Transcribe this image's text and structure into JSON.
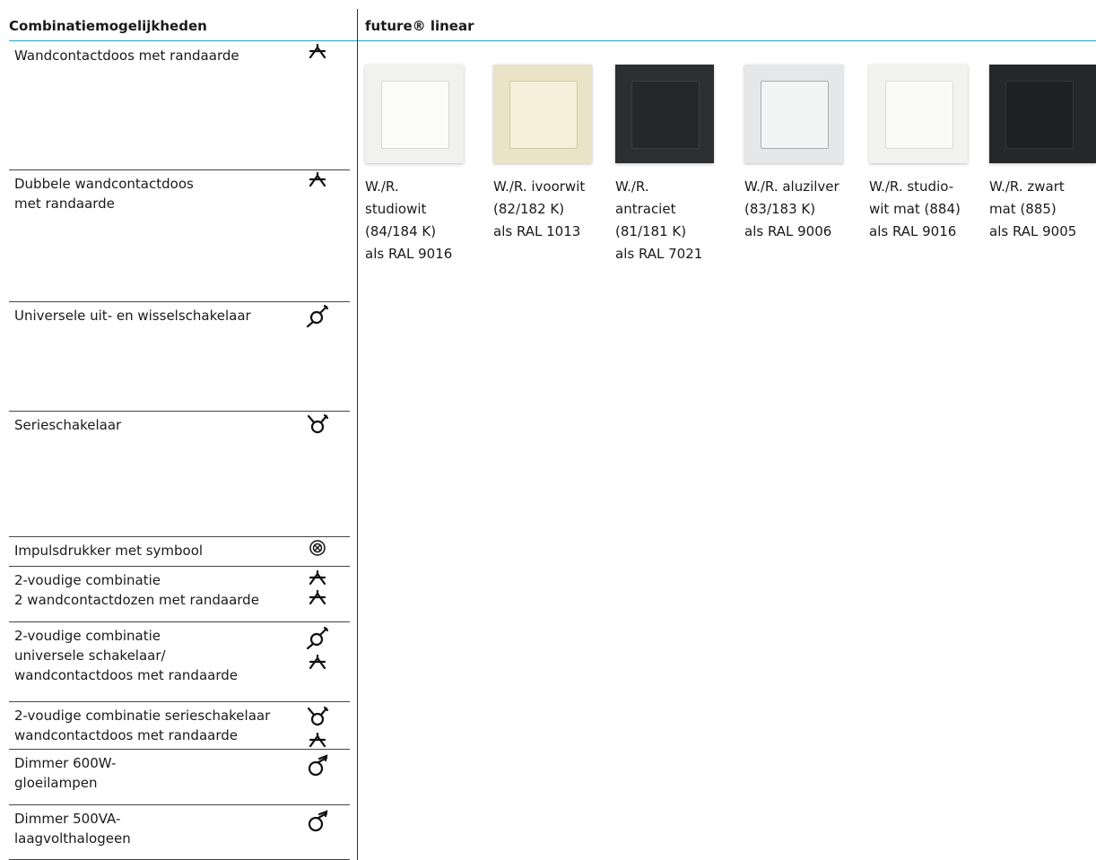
{
  "header": {
    "left_title": "Combinatiemogelijkheden",
    "right_title": "future® linear"
  },
  "rows": [
    {
      "label": "Wandcontactdoos met randaarde",
      "icons": [
        "socket-icon"
      ]
    },
    {
      "label": "Dubbele wandcontactdoos\nmet randaarde",
      "icons": [
        "socket-icon"
      ]
    },
    {
      "label": "Universele uit- en wisselschakelaar",
      "icons": [
        "universal-switch-icon"
      ]
    },
    {
      "label": "Serieschakelaar",
      "icons": [
        "series-switch-icon"
      ]
    },
    {
      "label": "Impulsdrukker met symbool",
      "icons": [
        "push-button-icon"
      ]
    },
    {
      "label": "2-voudige combinatie\n2 wandcontactdozen met randaarde",
      "icons": [
        "socket-icon",
        "socket-icon"
      ]
    },
    {
      "label": "2-voudige combinatie\nuniversele schakelaar/\nwandcontactdoos met randaarde",
      "icons": [
        "universal-switch-icon",
        "socket-icon"
      ]
    },
    {
      "label": "2-voudige combinatie serieschakelaar\nwandcontactdoos met randaarde",
      "icons": [
        "series-switch-icon",
        "socket-icon"
      ]
    },
    {
      "label": "Dimmer 600W-\ngloeilampen",
      "icons": [
        "dimmer-icon"
      ]
    },
    {
      "label": "Dimmer 500VA-\nlaagvolthalogeen",
      "icons": [
        "dimmer-icon"
      ]
    }
  ],
  "swatches": [
    {
      "caption": "W./R.\nstudiowit\n(84/184 K)\nals RAL 9016",
      "frame": "#f1f1ef",
      "plate": "#fbfbfa",
      "edge": "#d8d8d6"
    },
    {
      "caption": "W./R. ivoorwit\n(82/182 K)\nals RAL 1013",
      "frame": "#ebe3c8",
      "plate": "#f6efd9",
      "edge": "#d3c9a8"
    },
    {
      "caption": "W./R.\nantraciet\n(81/181 K)\nals RAL 7021",
      "frame": "#2c2f31",
      "plate": "#25282a",
      "edge": "#3b3f42"
    },
    {
      "caption": "W./R. aluzilver\n(83/183 K)\nals RAL 9006",
      "frame": "#e6e7e8",
      "plate": "#f3f4f4",
      "edge": "#a9acae"
    },
    {
      "caption": "W./R. studio-\nwit mat (884)\nals RAL 9016",
      "frame": "#f2f2f1",
      "plate": "#fafaf9",
      "edge": "#dcdcda"
    },
    {
      "caption": "W./R. zwart\nmat (885)\nals RAL 9005",
      "frame": "#262728",
      "plate": "#1f2021",
      "edge": "#333536"
    }
  ]
}
